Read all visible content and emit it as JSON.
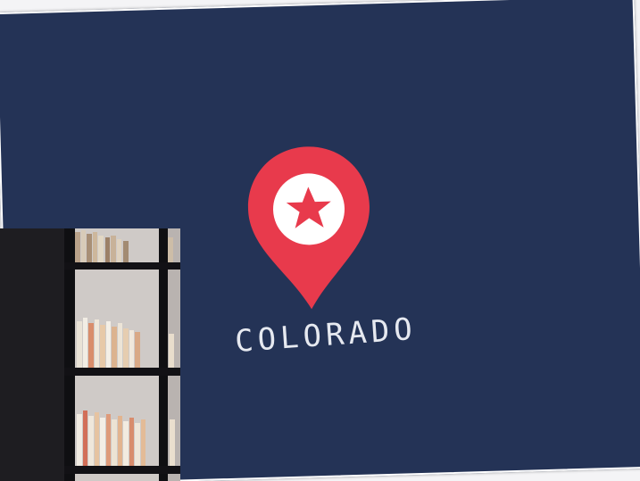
{
  "card": {
    "background_color": "#243356",
    "label": "COLORADO"
  },
  "pin": {
    "icon": "map-pin-star-icon",
    "pin_color": "#e83a4c",
    "inner_color": "#ffffff",
    "star_color": "#e83a4c"
  },
  "photo": {
    "icon": "bookshelf-photo",
    "shelf_color": "#1d1c20",
    "wall_color": "#d9d7d6"
  }
}
